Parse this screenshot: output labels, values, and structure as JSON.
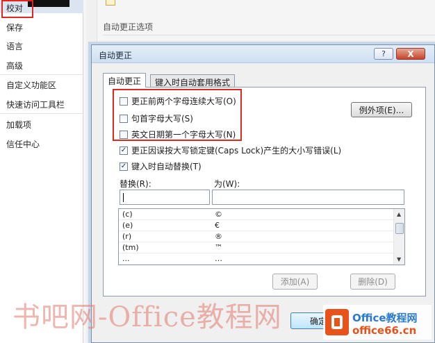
{
  "nav": {
    "items": [
      "校对",
      "保存",
      "语言",
      "高级",
      "自定义功能区",
      "快速访问工具栏",
      "加载项",
      "信任中心"
    ]
  },
  "background": {
    "section_header": "自动更正选项"
  },
  "dialog": {
    "title": "自动更正",
    "help_label": "?",
    "close_label": "X",
    "tabs": [
      "自动更正",
      "键入时自动套用格式"
    ],
    "checkboxes": [
      {
        "label": "更正前两个字母连续大写(O)",
        "checked": false
      },
      {
        "label": "句首字母大写(S)",
        "checked": false
      },
      {
        "label": "英文日期第一个字母大写(N)",
        "checked": false
      },
      {
        "label": "更正因误按大写锁定键(Caps Lock)产生的大小写错误(L)",
        "checked": true
      },
      {
        "label": "键入时自动替换(T)",
        "checked": true
      }
    ],
    "exceptions_button": "例外项(E)...",
    "replace_label": "替换(R):",
    "with_label": "为(W):",
    "replace_value": "",
    "with_value": "",
    "list_rows": [
      {
        "replace": "(c)",
        "with": "©"
      },
      {
        "replace": "(e)",
        "with": "€"
      },
      {
        "replace": "(r)",
        "with": "®"
      },
      {
        "replace": "(tm)",
        "with": "™"
      },
      {
        "replace": "...",
        "with": "…"
      }
    ],
    "add_button": "添加(A)",
    "delete_button": "删除(D)",
    "ok_button": "确定"
  },
  "overlay": {
    "watermark": "书吧网-Office教程网",
    "logo_line1": "Office教程网",
    "logo_line2": "office66.cn"
  },
  "colors": {
    "highlight_red": "#e0261f",
    "dialog_frame": "#c7d7ea"
  }
}
